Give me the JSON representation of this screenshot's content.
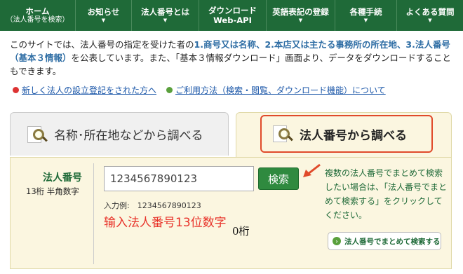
{
  "nav": {
    "items": [
      {
        "label": "ホーム",
        "sub": "（法人番号を検索）"
      },
      {
        "label": "お知らせ"
      },
      {
        "label": "法人番号とは"
      },
      {
        "label": "ダウンロード",
        "sub": "Web-API"
      },
      {
        "label": "英語表記の登録"
      },
      {
        "label": "各種手続"
      },
      {
        "label": "よくある質問"
      }
    ]
  },
  "intro": {
    "p1": "このサイトでは、法人番号の指定を受けた者の",
    "hl1": "1.商号又は名称、2.本店又は主たる事務所の所在地、3.法人番号（基本３情報）",
    "p2": "を公表しています。また、「基本３情報ダウンロード」画面より、データをダウンロードすることもできます。"
  },
  "links": {
    "new_registration": "新しく法人の設立登記をされた方へ",
    "usage": "ご利用方法（検索・閲覧、ダウンロード機能）について"
  },
  "tabs": {
    "by_name": "名称･所在地などから調べる",
    "by_number": "法人番号から調べる"
  },
  "form": {
    "label_title": "法人番号",
    "label_sub": "13桁 半角数字",
    "input_value": "1234567890123",
    "search_button": "検索",
    "example": "入力例:　1234567890123",
    "side_text": "複数の法人番号でまとめて検索したい場合は、「法人番号でまとめて検索する」をクリックしてください。",
    "multi_button": "法人番号でまとめて検索する"
  },
  "annotations": {
    "red_text": "输入法人番号13位数字",
    "black_text": "0桁"
  },
  "colors": {
    "nav_bg": "#1f6a38",
    "accent_red": "#e04a2a",
    "search_green": "#2f8a3f"
  }
}
